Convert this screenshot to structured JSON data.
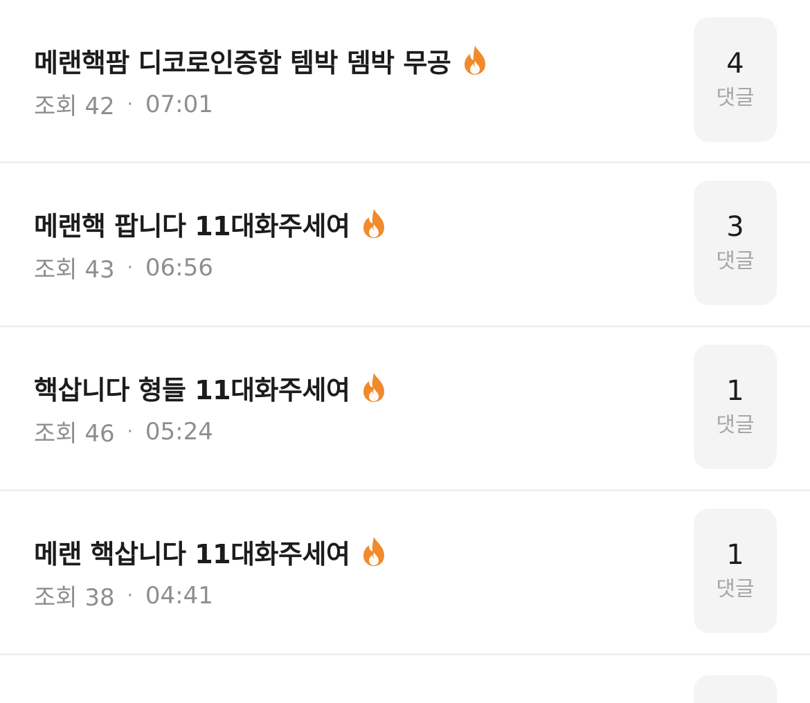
{
  "colors": {
    "accent_fire": "#f08a2c",
    "title_text": "#1c1c1c",
    "meta_text": "#8e8e8e",
    "comment_box_bg": "#f4f4f4"
  },
  "posts": [
    {
      "title": "메랜핵팜 디코로인증함 템박 뎀박 무공",
      "hot_icon": "fire-icon",
      "views_label": "조회 42",
      "separator": "·",
      "time": "07:01",
      "comment_count": "4",
      "comment_label": "댓글"
    },
    {
      "title": "메랜핵 팝니다 11대화주세여",
      "hot_icon": "fire-icon",
      "views_label": "조회 43",
      "separator": "·",
      "time": "06:56",
      "comment_count": "3",
      "comment_label": "댓글"
    },
    {
      "title": "핵삽니다 형들 11대화주세여",
      "hot_icon": "fire-icon",
      "views_label": "조회 46",
      "separator": "·",
      "time": "05:24",
      "comment_count": "1",
      "comment_label": "댓글"
    },
    {
      "title": "메랜 핵삽니다 11대화주세여",
      "hot_icon": "fire-icon",
      "views_label": "조회 38",
      "separator": "·",
      "time": "04:41",
      "comment_count": "1",
      "comment_label": "댓글"
    }
  ]
}
